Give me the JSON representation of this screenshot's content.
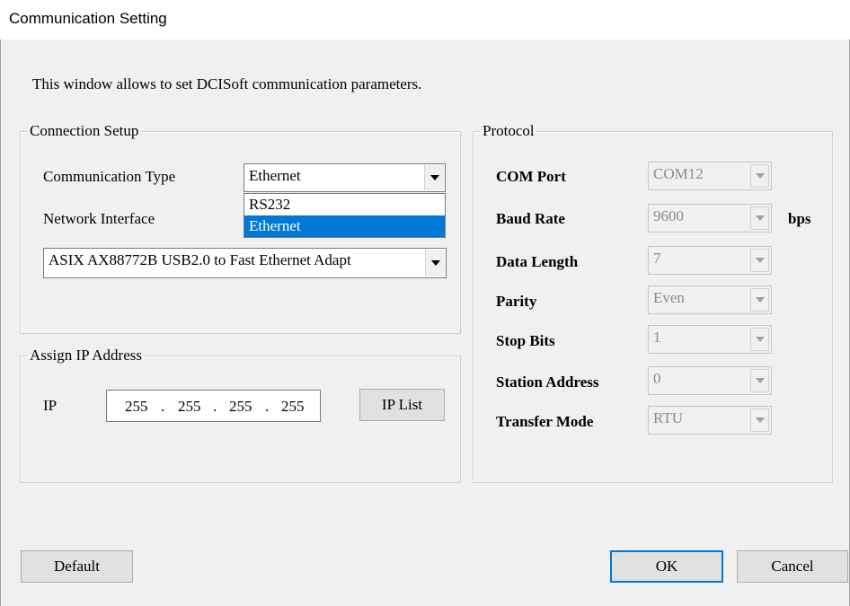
{
  "window": {
    "title": "Communication Setting"
  },
  "intro_text": "This window allows to set  DCISoft communication parameters.",
  "connection_setup": {
    "legend": "Connection Setup",
    "comm_type_label": "Communication Type",
    "comm_type_value": "Ethernet",
    "comm_type_options": [
      "RS232",
      "Ethernet"
    ],
    "network_interface_label": "Network Interface",
    "network_interface_value": "ASIX AX88772B USB2.0 to Fast Ethernet Adapt"
  },
  "assign_ip": {
    "legend": "Assign IP Address",
    "ip_label": "IP",
    "octets": [
      "255",
      "255",
      "255",
      "255"
    ],
    "dot": ".",
    "ip_list_button": "IP List"
  },
  "protocol": {
    "legend": "Protocol",
    "com_port_label": "COM Port",
    "com_port_value": "COM12",
    "baud_rate_label": "Baud Rate",
    "baud_rate_value": "9600",
    "baud_unit": "bps",
    "data_length_label": "Data Length",
    "data_length_value": "7",
    "parity_label": "Parity",
    "parity_value": "Even",
    "stop_bits_label": "Stop Bits",
    "stop_bits_value": "1",
    "station_address_label": "Station Address",
    "station_address_value": "0",
    "transfer_mode_label": "Transfer Mode",
    "transfer_mode_value": "RTU"
  },
  "buttons": {
    "default": "Default",
    "ok": "OK",
    "cancel": "Cancel"
  },
  "colors": {
    "selection": "#0078d7",
    "dialog_bg": "#f0f0f0"
  }
}
